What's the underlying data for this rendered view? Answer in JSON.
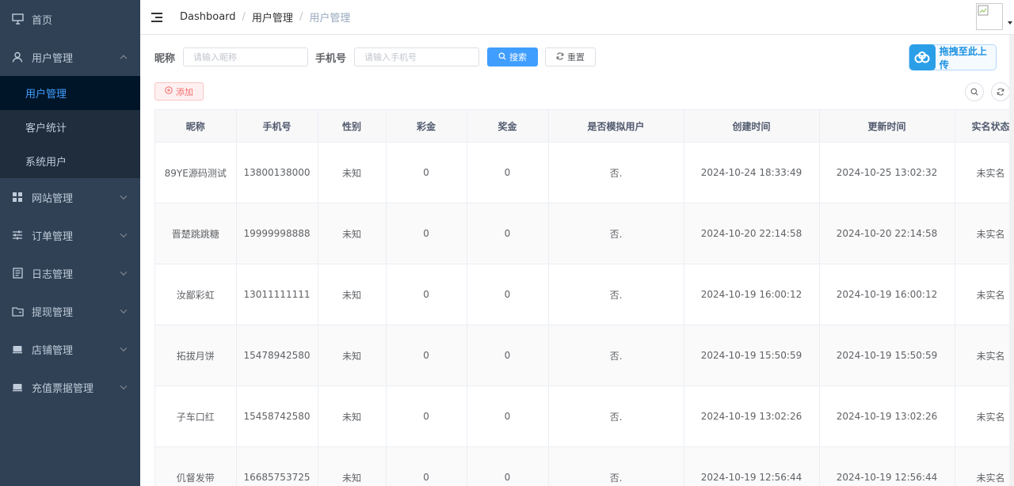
{
  "sidebar": {
    "items": [
      {
        "label": "首页",
        "icon": "monitor-icon"
      },
      {
        "label": "用户管理",
        "icon": "user-icon",
        "expanded": true,
        "children": [
          {
            "label": "用户管理",
            "active": true
          },
          {
            "label": "客户统计"
          },
          {
            "label": "系统用户"
          }
        ]
      },
      {
        "label": "网站管理",
        "icon": "grid-icon"
      },
      {
        "label": "订单管理",
        "icon": "sliders-icon"
      },
      {
        "label": "日志管理",
        "icon": "log-icon"
      },
      {
        "label": "提现管理",
        "icon": "folder-icon"
      },
      {
        "label": "店铺管理",
        "icon": "store-icon"
      },
      {
        "label": "充值票据管理",
        "icon": "store-icon"
      }
    ]
  },
  "header": {
    "breadcrumb": [
      "Dashboard",
      "用户管理",
      "用户管理"
    ]
  },
  "search": {
    "nickname_label": "昵称",
    "nickname_placeholder": "请输入昵称",
    "phone_label": "手机号",
    "phone_placeholder": "请输入手机号",
    "search_label": "搜索",
    "reset_label": "重置"
  },
  "upload": {
    "label": "拖拽至此上传"
  },
  "toolbar": {
    "add_label": "添加"
  },
  "table": {
    "columns": [
      "昵称",
      "手机号",
      "性别",
      "彩金",
      "奖金",
      "是否模拟用户",
      "创建时间",
      "更新时间",
      "实名状态"
    ],
    "rows": [
      [
        "89YE源码测试",
        "13800138000",
        "未知",
        "0",
        "0",
        "否.",
        "2024-10-24 18:33:49",
        "2024-10-25 13:02:32",
        "未实名"
      ],
      [
        "晋楚跳跳糖",
        "19999998888",
        "未知",
        "0",
        "0",
        "否.",
        "2024-10-20 22:14:58",
        "2024-10-20 22:14:58",
        "未实名"
      ],
      [
        "汝鄙彩虹",
        "13011111111",
        "未知",
        "0",
        "0",
        "否.",
        "2024-10-19 16:00:12",
        "2024-10-19 16:00:12",
        "未实名"
      ],
      [
        "拓拔月饼",
        "15478942580",
        "未知",
        "0",
        "0",
        "否.",
        "2024-10-19 15:50:59",
        "2024-10-19 15:50:59",
        "未实名"
      ],
      [
        "子车口红",
        "15458742580",
        "未知",
        "0",
        "0",
        "否.",
        "2024-10-19 13:02:26",
        "2024-10-19 13:02:26",
        "未实名"
      ],
      [
        "仉督发带",
        "16685753725",
        "未知",
        "0",
        "0",
        "否.",
        "2024-10-19 12:56:44",
        "2024-10-19 12:56:44",
        "未实名"
      ]
    ]
  },
  "colors": {
    "sidebar_bg": "#304156",
    "submenu_bg": "#1f2d3d",
    "active_text": "#409eff",
    "primary": "#409eff",
    "danger": "#f56c6c"
  }
}
